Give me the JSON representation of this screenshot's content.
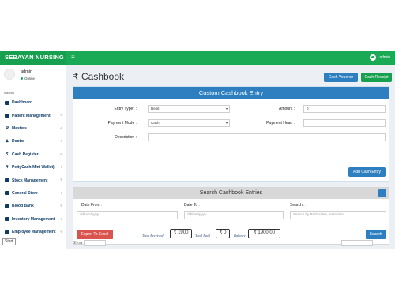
{
  "app": {
    "brand": "SEBAYAN NURSING",
    "menu_glyph": "≡",
    "user": "admin"
  },
  "profile": {
    "name": "admin",
    "status": "Online"
  },
  "sidebar": {
    "heading": "MENU",
    "items": [
      {
        "label": "Dashboard",
        "icon": "dashboard-icon",
        "has_submenu": false
      },
      {
        "label": "Patient Management",
        "icon": "patient-icon",
        "has_submenu": true
      },
      {
        "label": "Masters",
        "icon": "masters-icon",
        "has_submenu": true
      },
      {
        "label": "Doctor",
        "icon": "doctor-icon",
        "has_submenu": true
      },
      {
        "label": "Cash Register",
        "icon": "rupee-icon",
        "has_submenu": true
      },
      {
        "label": "PettyCash(Mini Wallet)",
        "icon": "wallet-icon",
        "has_submenu": true
      },
      {
        "label": "Stock Management",
        "icon": "stock-icon",
        "has_submenu": true
      },
      {
        "label": "General Store",
        "icon": "store-icon",
        "has_submenu": true
      },
      {
        "label": "Blood Bank",
        "icon": "blood-icon",
        "has_submenu": true
      },
      {
        "label": "Inventory Management",
        "icon": "inventory-icon",
        "has_submenu": true
      },
      {
        "label": "Employee Management",
        "icon": "employee-icon",
        "has_submenu": true
      }
    ]
  },
  "taskbar_tooltip": "Start",
  "page": {
    "title_symbol": "₹",
    "title": "Cashbook",
    "cash_voucher": "Cash Voucher",
    "cash_receipt": "Cash Receipt"
  },
  "entry": {
    "heading": "Custom Cashbook Entry",
    "entry_type_label": "Entry Type* :",
    "entry_type_value": "Debit",
    "amount_label": "Amount :",
    "amount_value": "0",
    "payment_mode_label": "Payment Mode :",
    "payment_mode_value": "Cash",
    "payment_head_label": "Payment Head :",
    "payment_head_value": "",
    "description_label": "Description :",
    "description_value": "",
    "add_button": "Add Cash Entry"
  },
  "search": {
    "heading": "Search Cashbook Entries",
    "collapse_glyph": "−",
    "date_from_label": "Date From :",
    "date_from_placeholder": "dd/mm/yyyy",
    "date_to_label": "Date To :",
    "date_to_placeholder": "dd/mm/yyyy",
    "search_label": "Search :",
    "search_placeholder": "Search by Particulars, Narration",
    "export_button": "Export To Excel",
    "total_received_label": "Total Received",
    "total_received_value": "₹ 1900",
    "total_paid_label": "Total Paid",
    "total_paid_value": "₹ 0",
    "balance_label": "Balance",
    "balance_value": "₹ 1900.00",
    "search_button": "Search"
  },
  "footer_fragment": "Show"
}
